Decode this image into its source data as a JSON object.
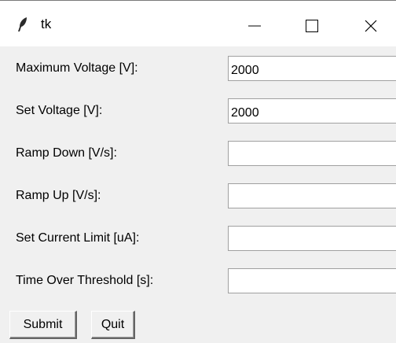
{
  "window": {
    "title": "tk",
    "icon": "feather-icon",
    "controls": {
      "minimize": "minimize-icon",
      "maximize": "maximize-icon",
      "close": "close-icon"
    }
  },
  "form": {
    "fields": [
      {
        "label": "Maximum Voltage [V]:",
        "value": "2000"
      },
      {
        "label": "Set Voltage [V]:",
        "value": "2000"
      },
      {
        "label": "Ramp Down [V/s]:",
        "value": ""
      },
      {
        "label": "Ramp Up [V/s]:",
        "value": ""
      },
      {
        "label": "Set Current Limit [uA]:",
        "value": ""
      },
      {
        "label": "Time Over Threshold [s]:",
        "value": ""
      }
    ]
  },
  "buttons": {
    "submit_label": "Submit",
    "quit_label": "Quit"
  }
}
